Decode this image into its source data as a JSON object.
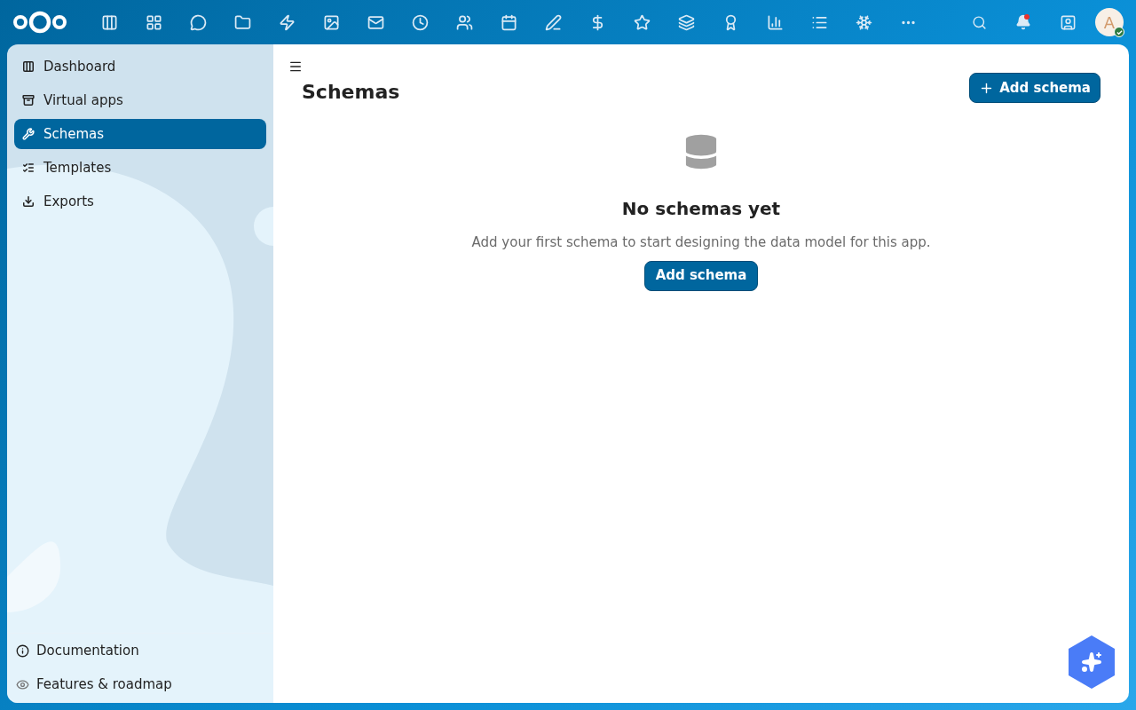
{
  "header": {
    "notifications_unread": true,
    "avatar": {
      "initial": "A",
      "online": true
    }
  },
  "sidebar": {
    "items": [
      {
        "label": "Dashboard",
        "selected": false
      },
      {
        "label": "Virtual apps",
        "selected": false
      },
      {
        "label": "Schemas",
        "selected": true
      },
      {
        "label": "Templates",
        "selected": false
      },
      {
        "label": "Exports",
        "selected": false
      }
    ],
    "footer_items": [
      {
        "label": "Documentation"
      },
      {
        "label": "Features & roadmap"
      }
    ]
  },
  "main": {
    "title": "Schemas",
    "primary_button": "Add schema",
    "empty_state": {
      "title": "No schemas yet",
      "description": "Add your first schema to start designing the data model for this app.",
      "button": "Add schema"
    }
  }
}
